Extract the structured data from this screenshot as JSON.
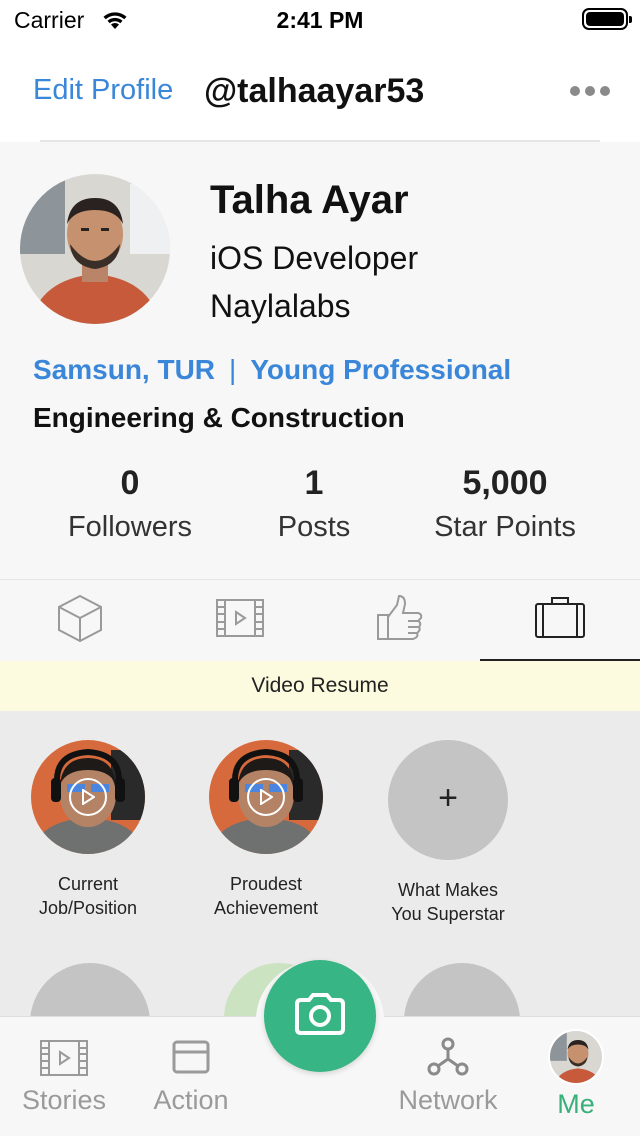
{
  "status_bar": {
    "carrier": "Carrier",
    "time": "2:41 PM"
  },
  "nav": {
    "edit_profile": "Edit Profile",
    "username": "@talhaayar53",
    "more_icon": "more-icon"
  },
  "profile": {
    "name": "Talha Ayar",
    "role": "iOS Developer",
    "company": "Naylalabs",
    "location": "Samsun, TUR",
    "separator": "|",
    "level": "Young Professional",
    "industry": "Engineering & Construction",
    "stats": [
      {
        "value": "0",
        "label": "Followers"
      },
      {
        "value": "1",
        "label": "Posts"
      },
      {
        "value": "5,000",
        "label": "Star Points"
      }
    ]
  },
  "tabs": [
    {
      "icon": "cube-icon",
      "active": false
    },
    {
      "icon": "film-icon",
      "active": false
    },
    {
      "icon": "thumbs-up-icon",
      "active": false
    },
    {
      "icon": "briefcase-icon",
      "active": true
    }
  ],
  "section": {
    "title": "Video Resume"
  },
  "resume_items": [
    {
      "label_line1": "Current",
      "label_line2": "Job/Position",
      "has_video": true
    },
    {
      "label_line1": "Proudest",
      "label_line2": "Achievement",
      "has_video": true
    },
    {
      "label_line1": "What Makes",
      "label_line2": "You Superstar",
      "has_video": false,
      "add_symbol": "+"
    }
  ],
  "tab_bar": {
    "items": [
      {
        "label": "Stories",
        "icon": "film-icon"
      },
      {
        "label": "Action",
        "icon": "card-icon"
      },
      {
        "label": "Network",
        "icon": "network-icon"
      },
      {
        "label": "Me",
        "icon": "avatar"
      }
    ],
    "camera_icon": "camera-icon"
  },
  "colors": {
    "accent_blue": "#3a86d8",
    "accent_green": "#37b584",
    "banner_bg": "#fdfbdf"
  }
}
